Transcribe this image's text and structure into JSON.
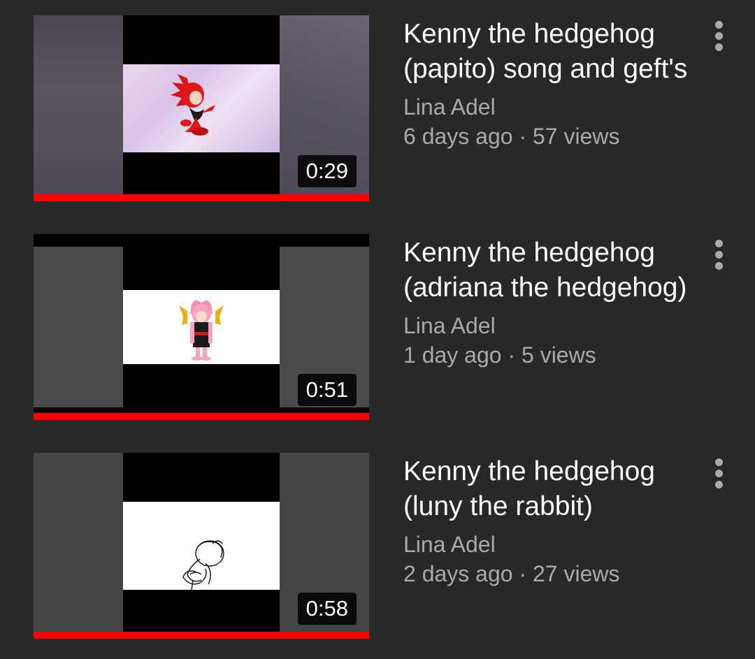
{
  "videos": [
    {
      "title": "Kenny the hedgehog (papito) song and geft's",
      "channel": "Lina Adel",
      "meta": "6 days ago · 57 views",
      "duration": "0:29",
      "watched_fraction": 1.0,
      "thumbnail": "red-hedgehog-character-on-purple-cloud-background"
    },
    {
      "title": "Kenny the hedgehog (adriana the hedgehog)",
      "channel": "Lina Adel",
      "meta": "1 day ago · 5 views",
      "duration": "0:51",
      "watched_fraction": 1.0,
      "thumbnail": "pink-hedgehog-character-on-white-background"
    },
    {
      "title": "Kenny the hedgehog (luny the rabbit)",
      "channel": "Lina Adel",
      "meta": "2 days ago · 27 views",
      "duration": "0:58",
      "watched_fraction": 1.0,
      "thumbnail": "pencil-sketch-on-white-background"
    }
  ],
  "colors": {
    "background": "#282828",
    "progress": "#ff0000",
    "title": "#ffffff",
    "secondary_text": "#aaaaaa"
  },
  "icons": {
    "menu": "more-vert-icon"
  }
}
